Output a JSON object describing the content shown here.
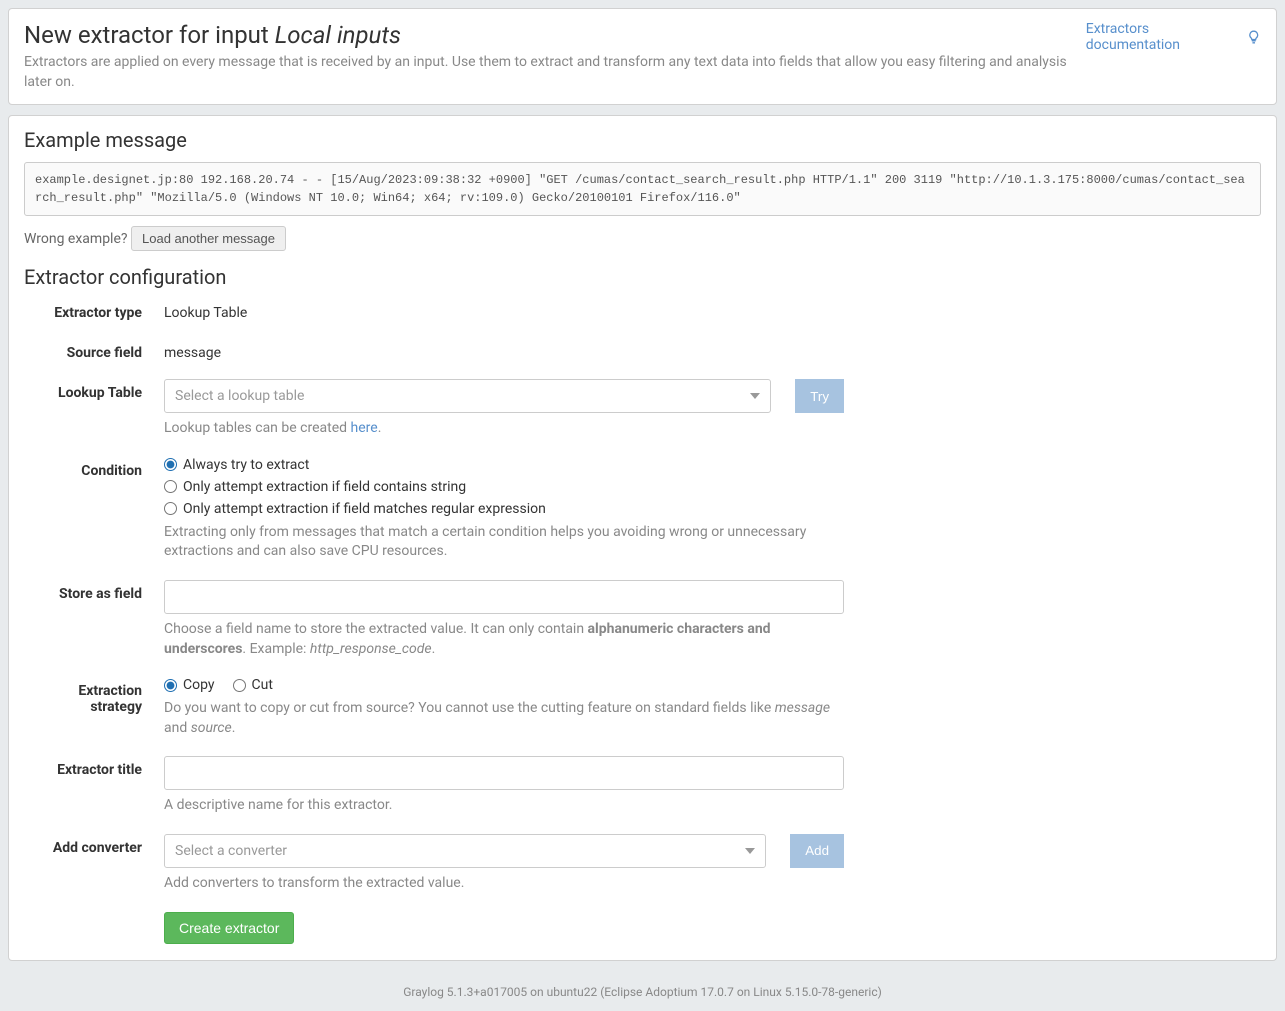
{
  "header": {
    "title_prefix": "New extractor for input ",
    "title_em": "Local inputs",
    "subtitle": "Extractors are applied on every message that is received by an input. Use them to extract and transform any text data into fields that allow you easy filtering and analysis later on.",
    "doc_link": "Extractors documentation"
  },
  "example": {
    "heading": "Example message",
    "content": "example.designet.jp:80 192.168.20.74 - - [15/Aug/2023:09:38:32 +0900] \"GET /cumas/contact_search_result.php HTTP/1.1\" 200 3119 \"http://10.1.3.175:8000/cumas/contact_search_result.php\" \"Mozilla/5.0 (Windows NT 10.0; Win64; x64; rv:109.0) Gecko/20100101 Firefox/116.0\"",
    "wrong_label": "Wrong example?",
    "load_button": "Load another message"
  },
  "config": {
    "heading": "Extractor configuration",
    "extractor_type": {
      "label": "Extractor type",
      "value": "Lookup Table"
    },
    "source_field": {
      "label": "Source field",
      "value": "message"
    },
    "lookup_table": {
      "label": "Lookup Table",
      "placeholder": "Select a lookup table",
      "try_button": "Try",
      "help_prefix": "Lookup tables can be created ",
      "help_link": "here",
      "help_suffix": "."
    },
    "condition": {
      "label": "Condition",
      "options": [
        "Always try to extract",
        "Only attempt extraction if field contains string",
        "Only attempt extraction if field matches regular expression"
      ],
      "selected": 0,
      "help": "Extracting only from messages that match a certain condition helps you avoiding wrong or unnecessary extractions and can also save CPU resources."
    },
    "store_as": {
      "label": "Store as field",
      "help_prefix": "Choose a field name to store the extracted value. It can only contain ",
      "help_strong": "alphanumeric characters and underscores",
      "help_mid": ". Example: ",
      "help_em": "http_response_code",
      "help_suffix": "."
    },
    "strategy": {
      "label": "Extraction strategy",
      "options": [
        "Copy",
        "Cut"
      ],
      "selected": 0,
      "help_prefix": "Do you want to copy or cut from source? You cannot use the cutting feature on standard fields like ",
      "help_em1": "message",
      "help_mid": " and ",
      "help_em2": "source",
      "help_suffix": "."
    },
    "title_field": {
      "label": "Extractor title",
      "help": "A descriptive name for this extractor."
    },
    "converter": {
      "label": "Add converter",
      "placeholder": "Select a converter",
      "add_button": "Add",
      "help": "Add converters to transform the extracted value."
    },
    "create_button": "Create extractor"
  },
  "footer": "Graylog 5.1.3+a017005 on ubuntu22 (Eclipse Adoptium 17.0.7 on Linux 5.15.0-78-generic)"
}
